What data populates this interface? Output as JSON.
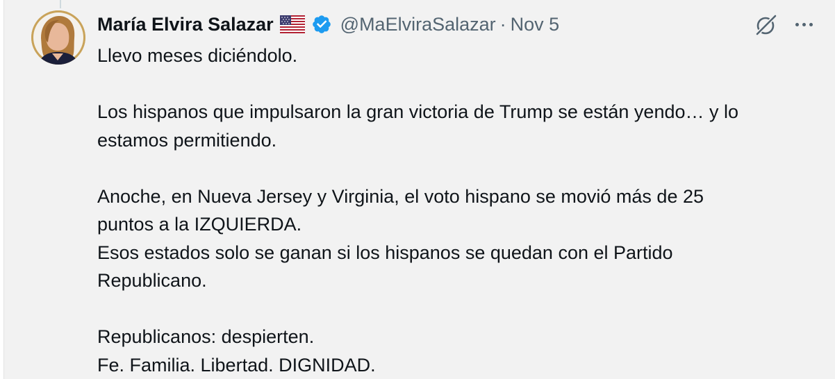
{
  "author": {
    "display_name": "María Elvira Salazar",
    "handle": "@MaElviraSalazar",
    "separator": "·",
    "date": "Nov 5",
    "flag_icon": "us-flag-icon",
    "verified_icon": "verified-badge-icon",
    "verified_color": "#1d9bf0"
  },
  "actions": {
    "grok_icon": "grok-icon",
    "more_icon": "more-options-icon"
  },
  "tweet": {
    "lines": [
      "Llevo meses diciéndolo.",
      "",
      "Los hispanos que impulsaron la gran victoria de Trump se están yendo… y lo",
      "estamos permitiendo.",
      "",
      "Anoche, en Nueva Jersey y Virginia, el voto hispano se movió más de 25",
      "puntos a la IZQUIERDA.",
      "Esos estados solo se ganan si los hispanos se quedan con el Partido",
      "Republicano.",
      "",
      "Republicanos: despierten.",
      "Fe. Familia. Libertad. DIGNIDAD."
    ]
  },
  "colors": {
    "background": "#f2f2f2",
    "text": "#0f1419",
    "secondary_text": "#536471"
  }
}
